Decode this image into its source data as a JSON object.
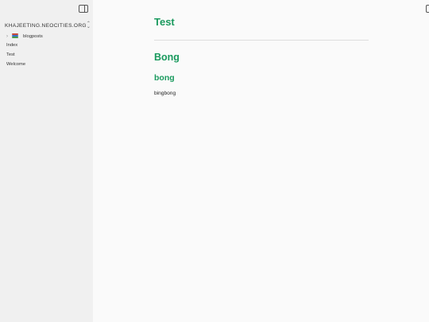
{
  "sidebar": {
    "vault_name": "KHAJEETING.NEOCITIES.ORG",
    "tree": {
      "folder": {
        "label": "blogposts",
        "icon": "books-icon",
        "collapsed": true
      },
      "files": [
        "Index",
        "Test",
        "Welcome"
      ]
    }
  },
  "main": {
    "page_title": "Test",
    "heading1": "Bong",
    "heading2": "bong",
    "paragraph": "bingbong"
  },
  "colors": {
    "heading": "#1a9a5e",
    "sidebar_bg": "#f0f0f0",
    "page_bg": "#fafafa"
  }
}
